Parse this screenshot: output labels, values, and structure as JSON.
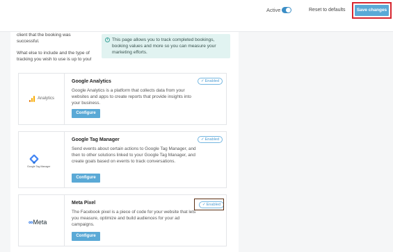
{
  "header": {
    "active_label": "Active",
    "reset_label": "Reset to defaults",
    "save_label": "Save changes"
  },
  "intro": {
    "line1": "client that the booking was successful.",
    "line2": "What else to include and the type of tracking you wish to use is up to you!"
  },
  "info": {
    "text": "This page allows you to track completed bookings, booking values and more so you can measure your marketing efforts."
  },
  "integrations": [
    {
      "name": "Google Analytics",
      "logo_text": "Analytics",
      "description": "Google Analytics is a platform that collects data from your websites and apps to create reports that provide insights into your business.",
      "status": "Enabled",
      "button": "Configure"
    },
    {
      "name": "Google Tag Manager",
      "logo_text": "Google Tag Manager",
      "description": "Send events about certain actions to Google Tag Manager, and then to other solutions linked to your Google Tag Manager, and create goals based on events to track conversations.",
      "status": "Enabled",
      "button": "Configure"
    },
    {
      "name": "Meta Pixel",
      "logo_text": "Meta",
      "description": "The Facebook pixel is a piece of code for your website that lets you measure, optimize and build audiences for your ad campaigns.",
      "status": "Enabled",
      "button": "Configure"
    }
  ],
  "colors": {
    "accent": "#5aa9d6",
    "highlight_outline": "#d6252e",
    "info_bg": "#e1f3f1"
  }
}
